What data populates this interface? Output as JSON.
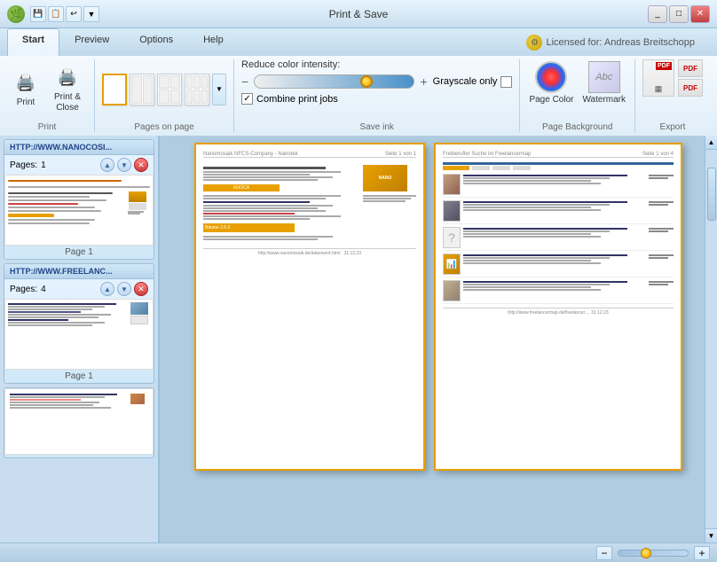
{
  "window": {
    "title": "Print & Save",
    "icon": "🌿"
  },
  "ribbon": {
    "tabs": [
      "Start",
      "Preview",
      "Options",
      "Help"
    ],
    "active_tab": "Start",
    "license_label": "Licensed for: Andreas Breitschopp"
  },
  "toolbar": {
    "print_label": "Print",
    "print_close_label": "Print &\nClose",
    "group_print_label": "Print",
    "pages_on_page_label": "Pages on page",
    "save_ink_label": "Save ink",
    "page_background_label": "Page Background",
    "export_label": "Export",
    "reduce_color_label": "Reduce color intensity:",
    "grayscale_label": "Grayscale only",
    "combine_label": "Combine print jobs",
    "page_color_label": "Page Color",
    "watermark_label": "Watermark"
  },
  "sidebar": {
    "items": [
      {
        "url": "HTTP://WWW.NANOCOSI...",
        "pages_label": "Pages:",
        "pages_count": "1",
        "page_label": "Page 1"
      },
      {
        "url": "HTTP://WWW.FREELANC...",
        "pages_label": "Pages:",
        "pages_count": "4",
        "page_label": "Page 1"
      }
    ]
  },
  "status_bar": {
    "zoom_minus": "−",
    "zoom_plus": "+"
  },
  "icons": {
    "printer": "🖨",
    "page_color": "🎨",
    "watermark": "Abc",
    "pdf": "PDF",
    "save": "💾",
    "open": "📂",
    "undo": "↩"
  }
}
